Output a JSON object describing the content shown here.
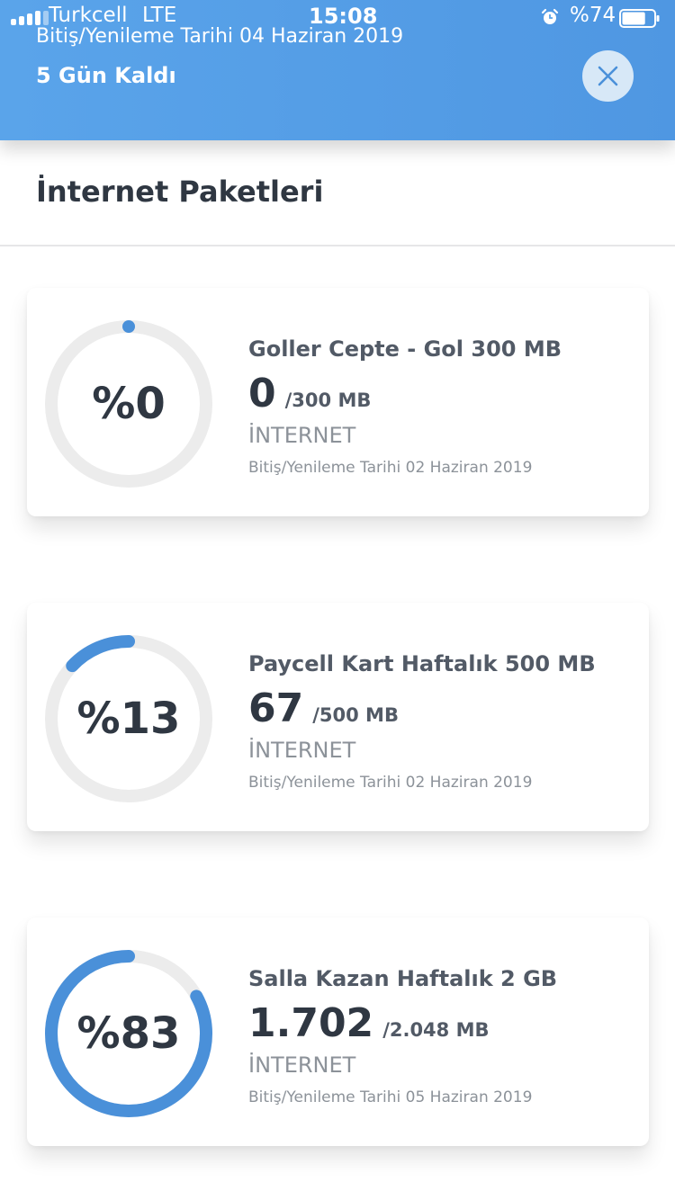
{
  "status_bar": {
    "carrier": "Turkcell",
    "network": "LTE",
    "time": "15:08",
    "battery_percent": "%74",
    "battery_level": 0.74
  },
  "header": {
    "renewal_text": "Bitiş/Yenileme Tarihi 04 Haziran 2019",
    "days_left": "5 Gün Kaldı"
  },
  "section_title": "İnternet Paketleri",
  "colors": {
    "accent": "#4a90d9",
    "header_bg": "#5aa4ea",
    "ring_track": "#ececec",
    "text_dark": "#2f3742",
    "text_muted": "#8c9299"
  },
  "packages": [
    {
      "name": "Goller Cepte - Gol 300 MB",
      "percent_label": "%0",
      "used": "0",
      "total": "/300 MB",
      "type": "İNTERNET",
      "renewal": "Bitiş/Yenileme Tarihi 02 Haziran 2019",
      "fraction": 0.0
    },
    {
      "name": "Paycell Kart Haftalık 500 MB",
      "percent_label": "%13",
      "used": "67",
      "total": "/500 MB",
      "type": "İNTERNET",
      "renewal": "Bitiş/Yenileme Tarihi 02 Haziran 2019",
      "fraction": 0.13
    },
    {
      "name": "Salla Kazan Haftalık 2 GB",
      "percent_label": "%83",
      "used": "1.702",
      "total": "/2.048 MB",
      "type": "İNTERNET",
      "renewal": "Bitiş/Yenileme Tarihi 05 Haziran 2019",
      "fraction": 0.83
    }
  ]
}
